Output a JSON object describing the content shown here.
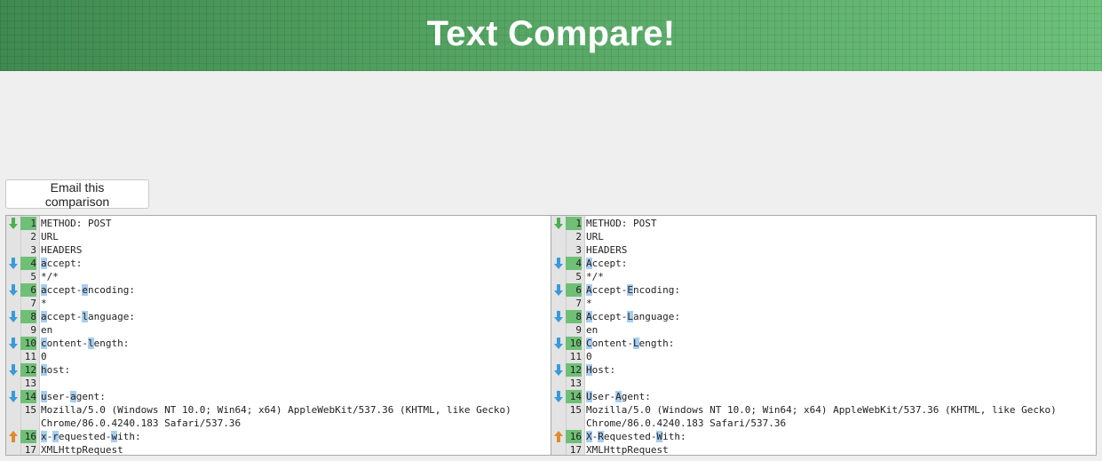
{
  "header": {
    "title": "Text Compare!"
  },
  "toolbar": {
    "email_label": "Email this comparison"
  },
  "colors": {
    "header_green": "#4f9a5f",
    "changed_line_bg": "#6fbf76",
    "char_highlight": "#a8cdef",
    "arrow_green": "#4caf50",
    "arrow_blue": "#3a9ad9",
    "arrow_orange": "#e08a2e"
  },
  "left_pane": {
    "lines": [
      {
        "num": "1",
        "arrow": "green-down-icon",
        "changed": true,
        "segments": [
          {
            "t": "METHOD: POST"
          }
        ]
      },
      {
        "num": "2",
        "segments": [
          {
            "t": "URL"
          }
        ]
      },
      {
        "num": "3",
        "segments": [
          {
            "t": "HEADERS"
          }
        ]
      },
      {
        "num": "4",
        "arrow": "blue-down-icon",
        "changed": true,
        "segments": [
          {
            "t": "a",
            "h": true
          },
          {
            "t": "ccept:"
          }
        ]
      },
      {
        "num": "5",
        "segments": [
          {
            "t": "*/*"
          }
        ]
      },
      {
        "num": "6",
        "arrow": "blue-down-icon",
        "changed": true,
        "segments": [
          {
            "t": "a",
            "h": true
          },
          {
            "t": "ccept-"
          },
          {
            "t": "e",
            "h": true
          },
          {
            "t": "ncoding:"
          }
        ]
      },
      {
        "num": "7",
        "segments": [
          {
            "t": "*"
          }
        ]
      },
      {
        "num": "8",
        "arrow": "blue-down-icon",
        "changed": true,
        "segments": [
          {
            "t": "a",
            "h": true
          },
          {
            "t": "ccept-"
          },
          {
            "t": "l",
            "h": true
          },
          {
            "t": "anguage:"
          }
        ]
      },
      {
        "num": "9",
        "segments": [
          {
            "t": "en"
          }
        ]
      },
      {
        "num": "10",
        "arrow": "blue-down-icon",
        "changed": true,
        "segments": [
          {
            "t": "c",
            "h": true
          },
          {
            "t": "ontent-"
          },
          {
            "t": "l",
            "h": true
          },
          {
            "t": "ength:"
          }
        ]
      },
      {
        "num": "11",
        "segments": [
          {
            "t": "0"
          }
        ]
      },
      {
        "num": "12",
        "arrow": "blue-down-icon",
        "changed": true,
        "segments": [
          {
            "t": "h",
            "h": true
          },
          {
            "t": "ost:"
          }
        ]
      },
      {
        "num": "13",
        "segments": [
          {
            "t": ""
          }
        ]
      },
      {
        "num": "14",
        "arrow": "blue-down-icon",
        "changed": true,
        "segments": [
          {
            "t": "u",
            "h": true
          },
          {
            "t": "ser-"
          },
          {
            "t": "a",
            "h": true
          },
          {
            "t": "gent:"
          }
        ]
      },
      {
        "num": "15",
        "wrap": true,
        "segments": [
          {
            "t": "Mozilla/5.0 (Windows NT 10.0; Win64; x64) AppleWebKit/537.36 (KHTML, like Gecko) Chrome/86.0.4240.183 Safari/537.36"
          }
        ]
      },
      {
        "num": "16",
        "arrow": "orange-up-icon",
        "changed": true,
        "segments": [
          {
            "t": "x",
            "h": true
          },
          {
            "t": "-"
          },
          {
            "t": "r",
            "h": true
          },
          {
            "t": "equested-"
          },
          {
            "t": "w",
            "h": true
          },
          {
            "t": "ith:"
          }
        ]
      },
      {
        "num": "17",
        "segments": [
          {
            "t": "XMLHttpRequest"
          }
        ]
      }
    ]
  },
  "right_pane": {
    "lines": [
      {
        "num": "1",
        "arrow": "green-down-icon",
        "changed": true,
        "segments": [
          {
            "t": "METHOD: POST"
          }
        ]
      },
      {
        "num": "2",
        "segments": [
          {
            "t": "URL"
          }
        ]
      },
      {
        "num": "3",
        "segments": [
          {
            "t": "HEADERS"
          }
        ]
      },
      {
        "num": "4",
        "arrow": "blue-down-icon",
        "changed": true,
        "segments": [
          {
            "t": "A",
            "h": true
          },
          {
            "t": "ccept:"
          }
        ]
      },
      {
        "num": "5",
        "segments": [
          {
            "t": "*/*"
          }
        ]
      },
      {
        "num": "6",
        "arrow": "blue-down-icon",
        "changed": true,
        "segments": [
          {
            "t": "A",
            "h": true
          },
          {
            "t": "ccept-"
          },
          {
            "t": "E",
            "h": true
          },
          {
            "t": "ncoding:"
          }
        ]
      },
      {
        "num": "7",
        "segments": [
          {
            "t": "*"
          }
        ]
      },
      {
        "num": "8",
        "arrow": "blue-down-icon",
        "changed": true,
        "segments": [
          {
            "t": "A",
            "h": true
          },
          {
            "t": "ccept-"
          },
          {
            "t": "L",
            "h": true
          },
          {
            "t": "anguage:"
          }
        ]
      },
      {
        "num": "9",
        "segments": [
          {
            "t": "en"
          }
        ]
      },
      {
        "num": "10",
        "arrow": "blue-down-icon",
        "changed": true,
        "segments": [
          {
            "t": "C",
            "h": true
          },
          {
            "t": "ontent-"
          },
          {
            "t": "L",
            "h": true
          },
          {
            "t": "ength:"
          }
        ]
      },
      {
        "num": "11",
        "segments": [
          {
            "t": "0"
          }
        ]
      },
      {
        "num": "12",
        "arrow": "blue-down-icon",
        "changed": true,
        "segments": [
          {
            "t": "H",
            "h": true
          },
          {
            "t": "ost:"
          }
        ]
      },
      {
        "num": "13",
        "segments": [
          {
            "t": ""
          }
        ]
      },
      {
        "num": "14",
        "arrow": "blue-down-icon",
        "changed": true,
        "segments": [
          {
            "t": "U",
            "h": true
          },
          {
            "t": "ser-"
          },
          {
            "t": "A",
            "h": true
          },
          {
            "t": "gent:"
          }
        ]
      },
      {
        "num": "15",
        "wrap": true,
        "segments": [
          {
            "t": "Mozilla/5.0 (Windows NT 10.0; Win64; x64) AppleWebKit/537.36 (KHTML, like Gecko) Chrome/86.0.4240.183 Safari/537.36"
          }
        ]
      },
      {
        "num": "16",
        "arrow": "orange-up-icon",
        "changed": true,
        "segments": [
          {
            "t": "X",
            "h": true
          },
          {
            "t": "-"
          },
          {
            "t": "R",
            "h": true
          },
          {
            "t": "equested-"
          },
          {
            "t": "W",
            "h": true
          },
          {
            "t": "ith:"
          }
        ]
      },
      {
        "num": "17",
        "segments": [
          {
            "t": "XMLHttpRequest"
          }
        ]
      }
    ]
  }
}
